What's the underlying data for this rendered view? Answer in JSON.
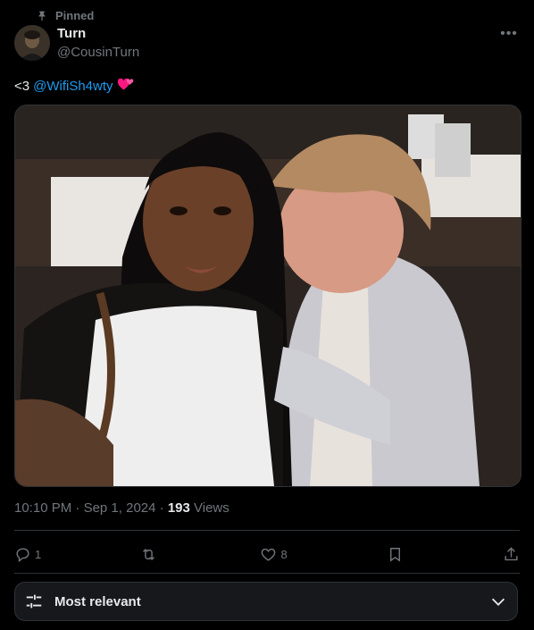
{
  "pinned": {
    "label": "Pinned",
    "icon": "pin-icon"
  },
  "author": {
    "name": "Turn",
    "handle": "@CousinTurn"
  },
  "tweet": {
    "text_prefix": "<3",
    "mention": "@WifiSh4wty",
    "emoji": "two-hearts-icon"
  },
  "meta": {
    "time": "10:10 PM",
    "separator1": " · ",
    "date": "Sep 1, 2024",
    "separator2": " · ",
    "views_count": "193",
    "views_label": " Views"
  },
  "actions": {
    "reply": {
      "icon": "reply-icon",
      "count": "1"
    },
    "retweet": {
      "icon": "retweet-icon",
      "count": ""
    },
    "like": {
      "icon": "heart-icon",
      "count": "8"
    },
    "bookmark": {
      "icon": "bookmark-icon"
    },
    "share": {
      "icon": "share-icon"
    }
  },
  "sort": {
    "label": "Most relevant",
    "icon": "filter-sliders-icon"
  },
  "colors": {
    "accent": "#1d9bf0",
    "secondary_text": "#71767b",
    "border": "#2f3336",
    "heart": "#f91880"
  }
}
